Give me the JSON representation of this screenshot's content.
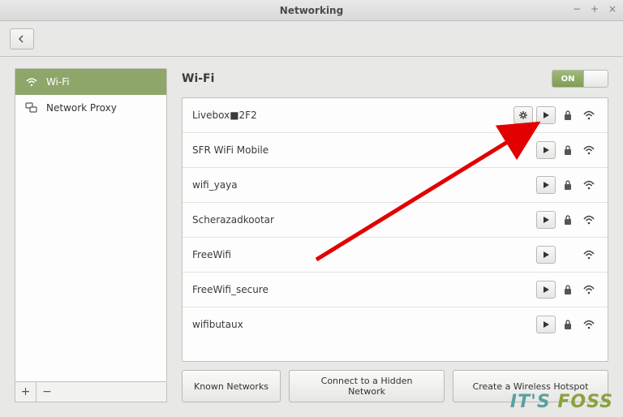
{
  "window": {
    "title": "Networking"
  },
  "sidebar": {
    "items": [
      {
        "label": "Wi-Fi"
      },
      {
        "label": "Network Proxy"
      }
    ]
  },
  "main": {
    "title": "Wi-Fi",
    "toggle_label": "ON",
    "networks": [
      {
        "name": "Livebox■2F2",
        "settings": true,
        "connect": true,
        "locked": true,
        "signal": true
      },
      {
        "name": "SFR WiFi Mobile",
        "settings": false,
        "connect": true,
        "locked": true,
        "signal": true
      },
      {
        "name": "wifi_yaya",
        "settings": false,
        "connect": true,
        "locked": true,
        "signal": true
      },
      {
        "name": "Scherazadkootar",
        "settings": false,
        "connect": true,
        "locked": true,
        "signal": true
      },
      {
        "name": "FreeWifi",
        "settings": false,
        "connect": true,
        "locked": false,
        "signal": true
      },
      {
        "name": "FreeWifi_secure",
        "settings": false,
        "connect": true,
        "locked": true,
        "signal": true
      },
      {
        "name": "wifibutaux",
        "settings": false,
        "connect": true,
        "locked": true,
        "signal": true
      }
    ],
    "buttons": {
      "known": "Known Networks",
      "hidden": "Connect to a Hidden Network",
      "hotspot": "Create a Wireless Hotspot"
    }
  },
  "watermark": {
    "its": "IT'S",
    "foss": " FOSS"
  }
}
